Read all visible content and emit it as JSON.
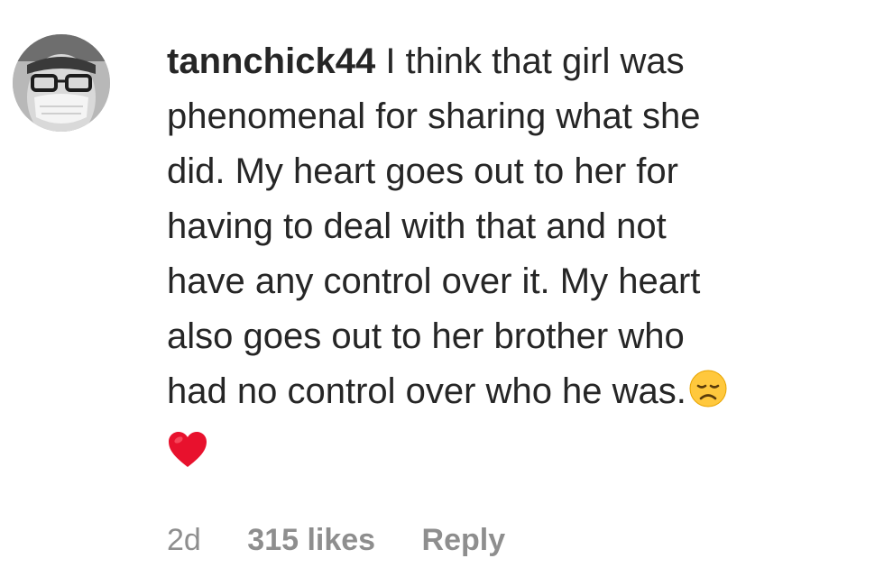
{
  "comment": {
    "username": "tannchick44",
    "text_lines": [
      " I think that girl was",
      "phenomenal for sharing what she",
      "did. My heart goes out to her for",
      "having to deal with that and not",
      "have any control over it. My heart",
      "also goes out to her brother who",
      "had no control over who he was."
    ],
    "emojis": [
      "disappointed-face",
      "red-heart"
    ]
  },
  "meta": {
    "time": "2d",
    "likes": "315 likes",
    "reply": "Reply"
  },
  "colors": {
    "text": "#262626",
    "secondary": "#8e8e8e",
    "emoji_yellow": "#ffc83d",
    "heart_red": "#e8112d"
  }
}
